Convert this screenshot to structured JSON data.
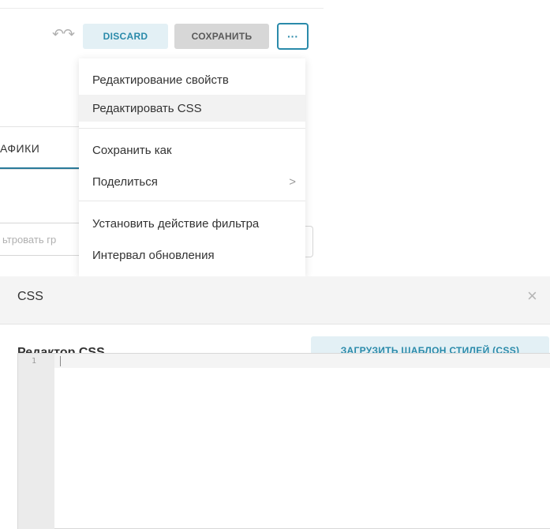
{
  "toolbar": {
    "undo_icon": "undo-icon",
    "redo_icon": "redo-icon",
    "discard_label": "DISCARD",
    "save_label": "СОХРАНИТЬ",
    "more_label": "···"
  },
  "background": {
    "tab_label": "АФИКИ",
    "filter_placeholder": "ьтровать гр"
  },
  "menu": {
    "items": [
      {
        "label": "Редактирование свойств"
      },
      {
        "label": "Редактировать CSS"
      },
      {
        "label": "Сохранить как"
      },
      {
        "label": "Поделиться"
      },
      {
        "label": "Установить действие фильтра"
      },
      {
        "label": "Интервал обновления"
      }
    ],
    "share_chevron": ">"
  },
  "modal": {
    "title": "CSS",
    "close_icon": "close-icon",
    "close_glyph": "×",
    "editor_label": "Редактор CSS",
    "load_button_label": "ЗАГРУЗИТЬ ШАБЛОН СТИЛЕЙ (CSS)",
    "line_number": "1"
  },
  "colors": {
    "accent": "#2a8aaa",
    "accent_bg": "#e3f0f5",
    "save_bg": "#d7d7d7"
  }
}
